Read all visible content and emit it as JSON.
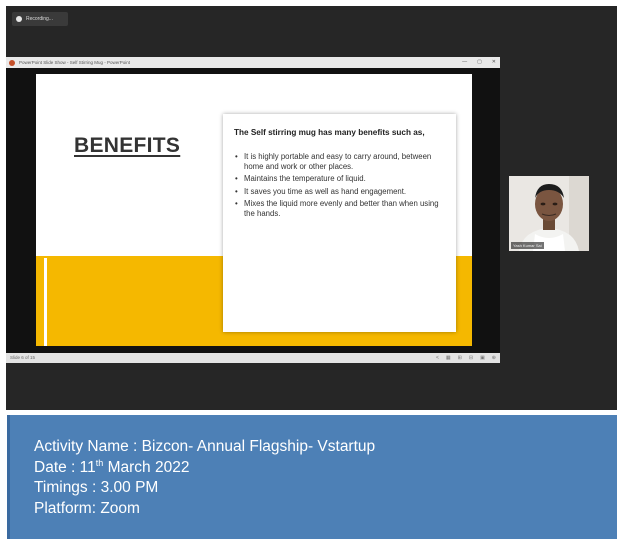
{
  "recording": {
    "label": "Recording..."
  },
  "powerpoint": {
    "title": "PowerPoint Slide Show - Self Stirring Mug - PowerPoint",
    "controls": [
      "—",
      "▢",
      "✕"
    ],
    "status_left": "Slide 6 of 15",
    "status_icons": [
      "<",
      "▦",
      "⊞",
      "⊟",
      "▣",
      "⊕"
    ]
  },
  "slide": {
    "title": "BENEFITS",
    "card_heading": "The Self stirring mug has many benefits such as,",
    "bullets": [
      "It is highly portable and easy to carry around, between home and work or other places.",
      "Maintains the temperature of liquid.",
      "It saves you time as well as hand engagement.",
      "Mixes the liquid more evenly and better than when using the hands."
    ]
  },
  "participant": {
    "name": "Yash Kumar Sai"
  },
  "info": {
    "activity": "Activity Name : Bizcon- Annual Flagship- Vstartup",
    "date_prefix": "Date : 11",
    "date_sup": "th",
    "date_suffix": " March 2022",
    "timings": "Timings : 3.00 PM",
    "platform": "Platform: Zoom"
  },
  "colors": {
    "accent_yellow": "#f5b800",
    "info_blue": "#4d80b6",
    "frame_dark": "#262626"
  }
}
